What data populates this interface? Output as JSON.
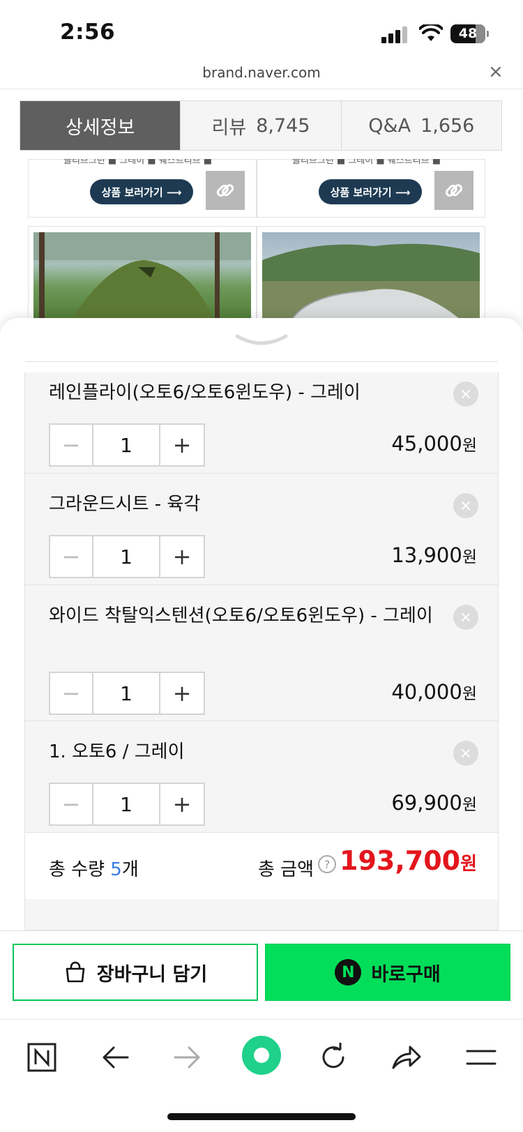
{
  "status_bar": {
    "time": "2:56",
    "battery": "48"
  },
  "browser": {
    "url": "brand.naver.com",
    "close_symbol": "×"
  },
  "tabs": [
    {
      "label": "상세정보",
      "count": "",
      "active": true
    },
    {
      "label": "리뷰",
      "count": "8,745",
      "active": false
    },
    {
      "label": "Q&A",
      "count": "1,656",
      "active": false
    }
  ],
  "background_cards": {
    "go_button_label": "상품 보러가기 ⟶",
    "legend_left": "올리브그린 ■ 그레이 ■ 웨스트리브 ■",
    "legend_right": "올리브그린 ■ 그레이 ■ 웨스트리브 ■"
  },
  "options": [
    {
      "name": "레인플라이(오토6/오토6윈도우) - 그레이",
      "quantity": "1",
      "price": "45,000",
      "currency": "원"
    },
    {
      "name": "그라운드시트 - 육각",
      "quantity": "1",
      "price": "13,900",
      "currency": "원"
    },
    {
      "name": "와이드 착탈익스텐션(오토6/오토6윈도우) - 그레이",
      "quantity": "1",
      "price": "40,000",
      "currency": "원"
    },
    {
      "name": "1. 오토6 / 그레이",
      "quantity": "1",
      "price": "69,900",
      "currency": "원"
    }
  ],
  "stepper": {
    "minus": "−",
    "plus": "+"
  },
  "remove_symbol": "×",
  "summary": {
    "total_qty_label": "총 수량 ",
    "total_qty": "5",
    "total_qty_unit": "개",
    "total_amount_label": "총 금액",
    "help_symbol": "?",
    "total_amount": "193,700",
    "currency": "원"
  },
  "actions": {
    "cart_label": "장바구니 담기",
    "buy_label": "바로구매",
    "buy_badge": "N"
  },
  "bottom_nav": [
    "n-home-icon",
    "back-arrow-icon",
    "forward-arrow-icon",
    "green-dot-icon",
    "reload-icon",
    "share-icon",
    "menu-icon"
  ],
  "colors": {
    "accent_green": "#03de5a",
    "price_red": "#e3161d",
    "qty_blue": "#3b7be3"
  }
}
